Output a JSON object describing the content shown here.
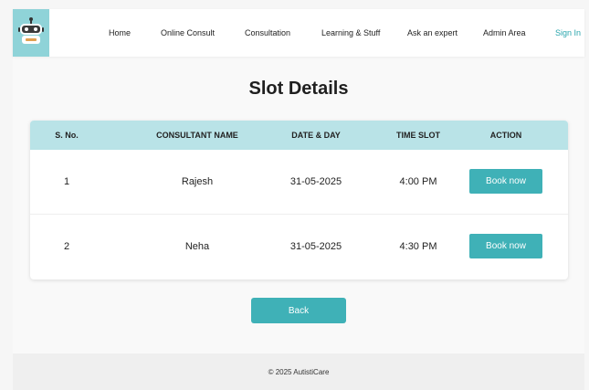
{
  "header": {
    "logo": "robot-logo",
    "nav": [
      "Home",
      "Online Consult",
      "Consultation",
      "Learning & Stuff",
      "Ask an expert",
      "Admin Area"
    ],
    "signin": "Sign In"
  },
  "title": "Slot Details",
  "table": {
    "headers": [
      "S. No.",
      "CONSULTANT NAME",
      "DATE & DAY",
      "TIME SLOT",
      "ACTION"
    ],
    "rows": [
      {
        "sno": "1",
        "name": "Rajesh",
        "date": "31-05-2025",
        "time": "4:00 PM",
        "action": "Book now"
      },
      {
        "sno": "2",
        "name": "Neha",
        "date": "31-05-2025",
        "time": "4:30 PM",
        "action": "Book now"
      }
    ]
  },
  "back_label": "Back",
  "footer": "© 2025 AutistiCare",
  "colors": {
    "accent": "#3fb1b7",
    "header_bg": "#b9e3e7",
    "logo_bg": "#8fd3d8",
    "signin": "#2aa6ad"
  }
}
